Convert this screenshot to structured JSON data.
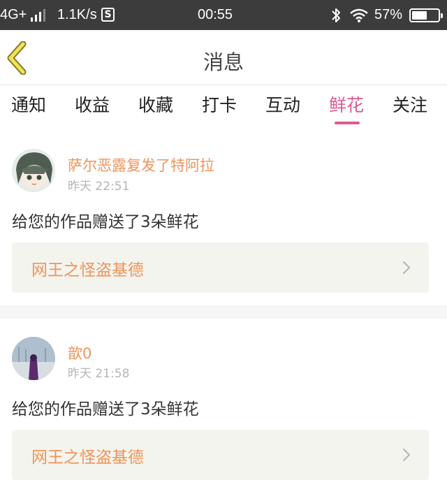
{
  "status_bar": {
    "network": "4G+",
    "speed": "1.1K/s",
    "s_icon": "S",
    "time": "00:55",
    "battery_pct": "57%",
    "battery_level": 0.57,
    "icons": [
      "signal-icon",
      "bluetooth-icon",
      "wifi-icon",
      "battery-icon"
    ]
  },
  "header": {
    "title": "消息",
    "back_icon": "chevron-left-icon",
    "back_color": "#e8d74a"
  },
  "tabs": [
    {
      "label": "通知"
    },
    {
      "label": "收益"
    },
    {
      "label": "收藏"
    },
    {
      "label": "打卡"
    },
    {
      "label": "互动"
    },
    {
      "label": "鲜花",
      "active": true
    },
    {
      "label": "关注"
    }
  ],
  "colors": {
    "accent": "#e05a94",
    "sender": "#f0935a",
    "status_bar": "#3c3c3c",
    "link_bg": "#f4f4ee"
  },
  "messages": [
    {
      "sender": "萨尔恶露复发了特阿拉",
      "time": "昨天 22:51",
      "text": "给您的作品赠送了3朵鲜花",
      "work_title": "网王之怪盗基德"
    },
    {
      "sender": "歆0",
      "time": "昨天 21:58",
      "text": "给您的作品赠送了3朵鲜花",
      "work_title": "网王之怪盗基德"
    }
  ]
}
